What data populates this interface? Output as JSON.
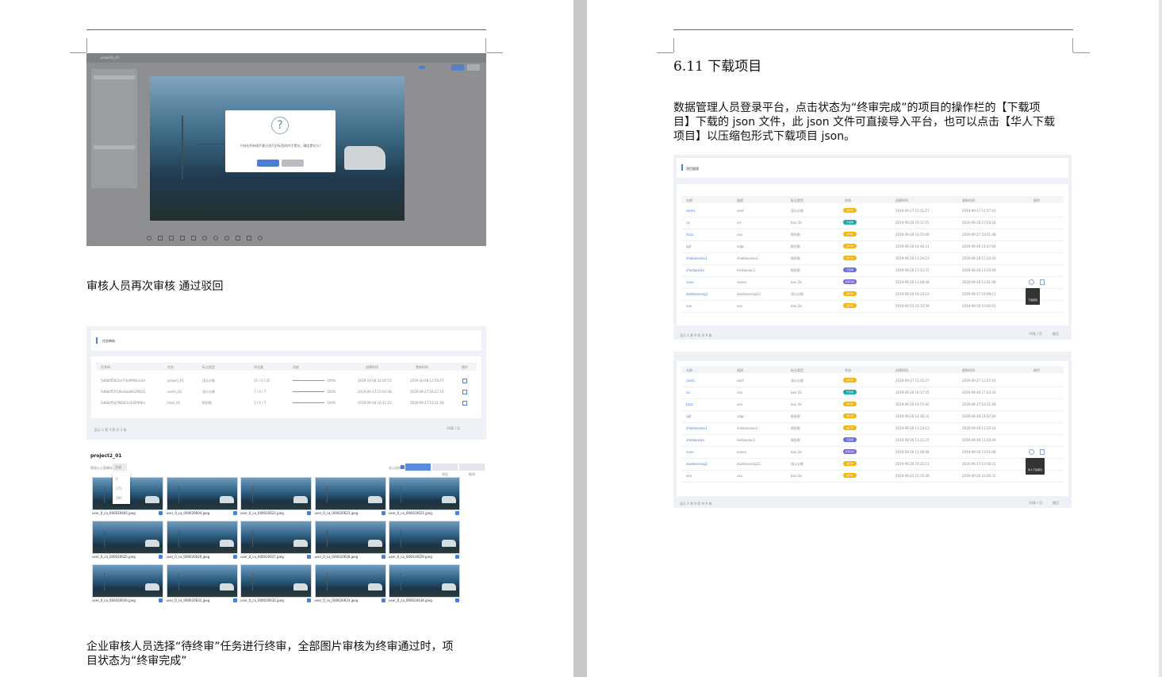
{
  "left_page": {
    "caption1": "审核人员再次审核 通过驳回",
    "caption2_line1": "企业审核人员选择“待终审”任务进行终审，全部图片审核为终审通过时，项",
    "caption2_line2": "目状态为“终审完成”",
    "screenshot1": {
      "project_title": "project2_01",
      "dialog_text": "只有在所有图片都已经打好标签的时才提交。确定提交么?",
      "confirm_label": "确定",
      "cancel_label": "取消"
    },
    "screenshot2": {
      "section_title": "任务审核",
      "columns": [
        "任务ID",
        "任务",
        "标注类型",
        "作业量",
        "进度",
        "创建时间",
        "更新时间",
        "操作"
      ],
      "rows": [
        [
          "5d6b0f5831e77bd9fd6ca3d",
          "project_01",
          "语义分割",
          "35 / 0 / 35",
          "100%",
          "2019-10-08 14:56:53",
          "2019-10-08 11:56:47"
        ],
        [
          "5d6b0f5f7c9e1bad0e3f6621",
          "sanfu_02",
          "语义分割",
          "7 / 0 / 7",
          "100%",
          "2019-09-27 15:02:58",
          "2019-09-27 16:27:16"
        ],
        [
          "5d6b0f5d7982b1c5d3f49ba",
          "hzzx_01",
          "矩形框",
          "7 / 0 / 7",
          "100%",
          "2019-09-04 16:11:21",
          "2019-09-27 15:21:48"
        ]
      ],
      "footer_total": "显示 1 到 3 项 共 3 条",
      "pager_size": "10条 / 页"
    },
    "screenshot3": {
      "title": "project2_01",
      "filter_label": "筛选以上图像标注",
      "filter_value": "全部",
      "dropdown_options": [
        "0",
        "172",
        "300"
      ],
      "toggle_label": "显示选择",
      "buttons": [
        "确定",
        "驳回",
        "取消"
      ],
      "images": [
        "user_0_ca_000020605.jpeg",
        "user_0_ca_000020604.jpeg",
        "user_0_ca_000020622.jpeg",
        "user_0_ca_000020623.jpeg",
        "user_0_ca_000020621.jpeg",
        "user_0_ca_000020625.jpeg",
        "user_0_ca_000020626.jpeg",
        "user_0_ca_000020627.jpeg",
        "user_0_ca_000020628.jpeg",
        "user_0_ca_000020629.jpeg",
        "user_0_ca_000020630.jpeg",
        "user_0_ca_000020631.jpeg",
        "user_0_ca_000020632.jpeg",
        "user_0_ca_000020633.jpeg",
        "user_0_ca_000020634.jpeg"
      ]
    }
  },
  "right_page": {
    "heading": "6.11 下载项目",
    "paragraph_line1": "数据管理人员登录平台，点击状态为“终审完成”的项目的操作栏的【下载项",
    "paragraph_line2": "目】下载的 json 文件，此 json 文件可直接导入平台，也可以点击【华人下载",
    "paragraph_line3": "项目】以压缩包形式下载项目 json。",
    "table_title": "项目管理",
    "columns": [
      "名称",
      "描述",
      "标注类型",
      "状态",
      "创建时间",
      "更新时间",
      "操作"
    ],
    "table1_rows": [
      {
        "name": "sanfu",
        "desc": "sanf",
        "type": "语义分割",
        "status": "进行中",
        "color": "#f5b50a",
        "created": "2019-09-27 15:51:27",
        "updated": "2019-09-27 11:57:43"
      },
      {
        "name": "xx",
        "desc": "xd",
        "type": "box 2d",
        "status": "已完成",
        "color": "#1ba6a6",
        "created": "2019-09-26 16:17:25",
        "updated": "2019-09-26 17:03:24"
      },
      {
        "name": "hzzx",
        "desc": "xxx",
        "type": "矩形框",
        "status": "进行中",
        "color": "#f5b50a",
        "created": "2019-09-26 14:55:46",
        "updated": "2019-09-27 10:21:48"
      },
      {
        "name": "sgf",
        "desc": "sdgs",
        "type": "矩形框",
        "status": "进行中",
        "color": "#f5b50a",
        "created": "2019-09-26 14:46:31",
        "updated": "2019-09-26 14:47:04"
      },
      {
        "name": "chebiaoxian1",
        "desc": "chebiaoxian1",
        "type": "矩形框",
        "status": "进行中",
        "color": "#f5b50a",
        "created": "2019-09-26 11:24:13",
        "updated": "2019-09-26 11:24:43"
      },
      {
        "name": "chedaoxian",
        "desc": "hedaoxian1",
        "type": "矩形框",
        "status": "已完成",
        "color": "#6a6fd8",
        "created": "2019-09-26 11:22:37",
        "updated": "2019-09-26 11:24:49"
      },
      {
        "name": "xxxx",
        "desc": "xxxxx",
        "type": "box 2d",
        "status": "终审完成",
        "color": "#7a5fd6",
        "created": "2019-09-26 11:08:48",
        "updated": "2019-09-26 13:01:08"
      },
      {
        "name": "duobianxing1",
        "desc": "duobianxing12",
        "type": "语义分割",
        "status": "进行中",
        "color": "#f5b50a",
        "created": "2019-09-26 16:20:13",
        "updated": "2019-09-27 10:09:21"
      },
      {
        "name": "xxx",
        "desc": "xxx",
        "type": "box 2d",
        "status": "进行中",
        "color": "#f5b50a",
        "created": "2019-09-25 21:15:39",
        "updated": "2019-09-26 10:00:31"
      }
    ],
    "table2_rows": [
      {
        "name": "sanfu",
        "desc": "sanf",
        "type": "语义分割",
        "status": "进行中",
        "color": "#f5b50a",
        "created": "2019-09-27 15:51:27",
        "updated": "2019-09-27 11:57:43"
      },
      {
        "name": "xx",
        "desc": "xxx",
        "type": "box 2d",
        "status": "已完成",
        "color": "#1ba6a6",
        "created": "2019-09-26 16:17:25",
        "updated": "2019-09-26 17:03:24"
      },
      {
        "name": "hzzx",
        "desc": "xxx",
        "type": "box 2d",
        "status": "进行中",
        "color": "#f5b50a",
        "created": "2019-09-26 14:55:46",
        "updated": "2019-09-27 10:21:48"
      },
      {
        "name": "sgf",
        "desc": "sdgs",
        "type": "矩形框",
        "status": "进行中",
        "color": "#f5b50a",
        "created": "2019-09-26 14:46:31",
        "updated": "2019-09-26 14:47:04"
      },
      {
        "name": "chebiaoxian1",
        "desc": "chebiaoxian1",
        "type": "矩形框",
        "status": "进行中",
        "color": "#f5b50a",
        "created": "2019-09-26 11:24:13",
        "updated": "2019-09-26 11:24:43"
      },
      {
        "name": "chedaoxian",
        "desc": "hedaoxian1",
        "type": "矩形框",
        "status": "已完成",
        "color": "#6a6fd8",
        "created": "2019-09-26 11:22:37",
        "updated": "2019-09-26 11:24:49"
      },
      {
        "name": "xxxx",
        "desc": "xxxxx",
        "type": "box 2d",
        "status": "终审完成",
        "color": "#7a5fd6",
        "created": "2019-09-26 11:08:48",
        "updated": "2019-09-26 13:01:08"
      },
      {
        "name": "duobianxing1",
        "desc": "duobianxing12",
        "type": "语义分割",
        "status": "进行中",
        "color": "#f5b50a",
        "created": "2019-09-26 16:20:13",
        "updated": "2019-09-27 10:09:21"
      },
      {
        "name": "xxx",
        "desc": "xxx",
        "type": "box 2d",
        "status": "进行中",
        "color": "#f5b50a",
        "created": "2019-09-25 21:15:39",
        "updated": "2019-09-26 10:00:31"
      }
    ],
    "tooltip1": "下载项目",
    "tooltip2": "华人下载项目",
    "footer_total": "显示 1 到 9 项 共 9 条",
    "pager_size": "10条 / 页",
    "pager_goto": "跳至"
  }
}
